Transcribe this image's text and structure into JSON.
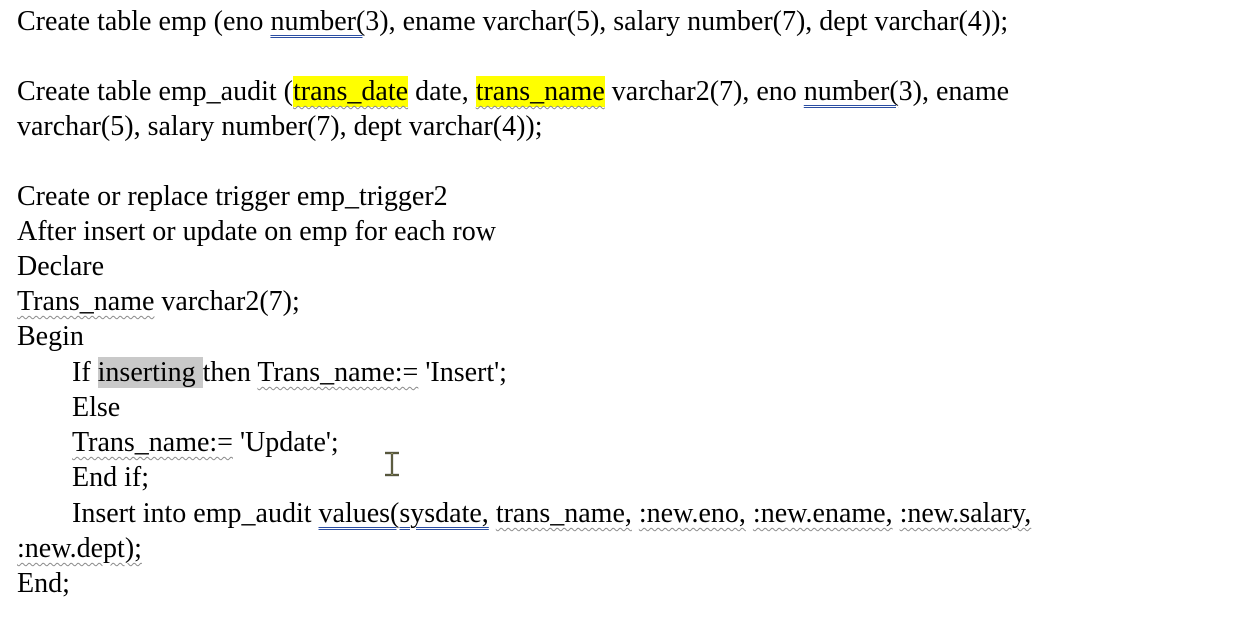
{
  "document": {
    "l1": {
      "a": "Create table emp (eno ",
      "b": "number(",
      "c": "3), ename varchar(5), salary number(7), dept varchar(4));"
    },
    "l2": {
      "a": "Create table emp_audit (",
      "b": "trans_date",
      "c": " date, ",
      "d": "trans_name",
      "e": " varchar2(7), eno ",
      "f": "number(",
      "g": "3), ename"
    },
    "l3": "varchar(5), salary number(7), dept varchar(4));",
    "l4": "Create or replace trigger emp_trigger2",
    "l5": "After insert or update on emp for each row",
    "l6": "Declare",
    "l7": {
      "a": "Trans_name",
      "b": " varchar2(7);"
    },
    "l8": "Begin",
    "l9": {
      "a": "If ",
      "b": "inserting ",
      "c": "then ",
      "d": "Trans_name:=",
      "e": " 'Insert';"
    },
    "l10": "Else",
    "l11": {
      "a": "Trans_name:=",
      "b": " 'Update';"
    },
    "l12": "End if;",
    "l13": {
      "a": "Insert into emp_audit ",
      "b": "values(sysdate,",
      "c": " ",
      "d": "trans_name,",
      "e": " ",
      "f": ":new.eno,",
      "g": " ",
      "h": ":new.ename,",
      "i": " ",
      "j": ":new.salary,"
    },
    "l14": {
      "a": ":new.dept);"
    },
    "l15": "End;"
  },
  "colors": {
    "highlight_yellow": "#ffff00",
    "highlight_grey": "#c9c9c9",
    "spell_underline": "#8a8a8a",
    "grammar_underline": "#2b4ea2"
  },
  "icons": {
    "cursor": "text-ibeam-cursor-icon"
  }
}
